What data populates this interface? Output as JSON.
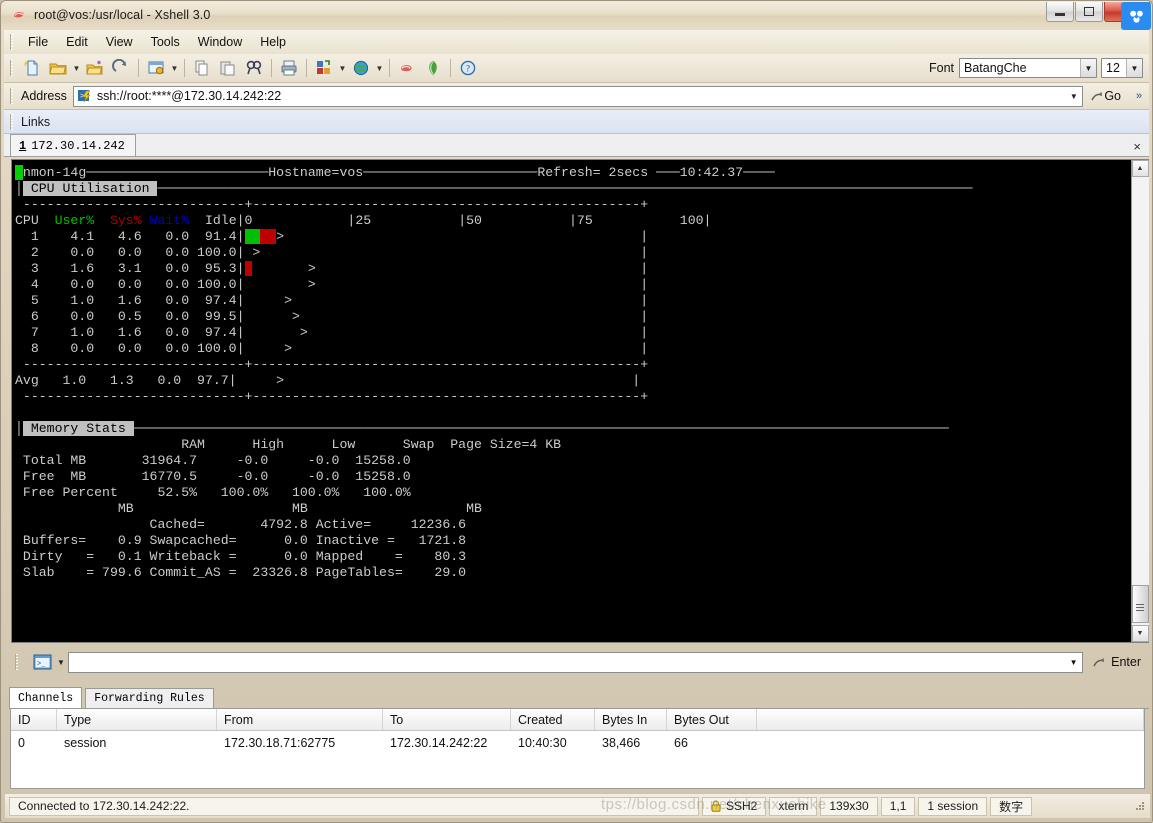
{
  "window": {
    "title": "root@vos:/usr/local - Xshell 3.0",
    "app_icon": "xshell-icon",
    "minimize_label": "Minimize",
    "maximize_label": "Maximize",
    "close_label": "X",
    "overlay_badge": "cloud-badge-icon"
  },
  "menubar": {
    "items": [
      "File",
      "Edit",
      "View",
      "Tools",
      "Window",
      "Help"
    ]
  },
  "toolbar": {
    "buttons": [
      {
        "name": "new-session-icon",
        "glyph": "new"
      },
      {
        "name": "open-folder-icon",
        "glyph": "folder"
      },
      {
        "name": "open-dropdown-arrow",
        "glyph": "arrow"
      },
      {
        "name": "open-session-icon",
        "glyph": "folder2"
      },
      {
        "name": "reconnect-icon",
        "glyph": "reconnect"
      },
      {
        "name": "properties-icon",
        "glyph": "props"
      },
      {
        "name": "properties-dropdown-arrow",
        "glyph": "arrow"
      },
      {
        "name": "copy-icon",
        "glyph": "copy"
      },
      {
        "name": "paste-icon",
        "glyph": "paste"
      },
      {
        "name": "find-icon",
        "glyph": "find"
      },
      {
        "name": "print-icon",
        "glyph": "print"
      },
      {
        "name": "transfer-icon",
        "glyph": "transfer"
      },
      {
        "name": "transfer-dropdown-arrow",
        "glyph": "arrow"
      },
      {
        "name": "web-icon",
        "glyph": "globe"
      },
      {
        "name": "web-dropdown-arrow",
        "glyph": "arrow"
      },
      {
        "name": "xshell-icon",
        "glyph": "xshell"
      },
      {
        "name": "xftp-icon",
        "glyph": "xftp"
      },
      {
        "name": "help-icon",
        "glyph": "help"
      }
    ],
    "font_label": "Font",
    "font_name": "BatangChe",
    "font_size": "12"
  },
  "address": {
    "label": "Address",
    "value": "ssh://root:****@172.30.14.242:22",
    "go_label": "Go",
    "chevron": "»"
  },
  "links": {
    "label": "Links"
  },
  "session_tab": {
    "number": "1",
    "name": "172.30.14.242",
    "close": "×"
  },
  "terminal": {
    "nmon": {
      "cursor": " ",
      "header_app": "nmon-14g",
      "header_hostname": "Hostname=vos",
      "header_refresh": "Refresh= 2secs",
      "header_time": "10:42.37",
      "cpu_panel_title": "CPU Utilisation",
      "cpu_columns": [
        "CPU",
        "User%",
        "Sys%",
        "Wait%",
        "Idle"
      ],
      "scale_labels": [
        "0",
        "|25",
        "|50",
        "|75",
        "100|"
      ],
      "cpu_rows": [
        {
          "cpu": "1",
          "user": "4.1",
          "sys": "4.6",
          "wait": "0.0",
          "idle": "91.4",
          "bar_u": 2,
          "bar_s": 2,
          "marker": 3
        },
        {
          "cpu": "2",
          "user": "0.0",
          "sys": "0.0",
          "wait": "0.0",
          "idle": "100.0",
          "bar_u": 0,
          "bar_s": 0,
          "marker": 1
        },
        {
          "cpu": "3",
          "user": "1.6",
          "sys": "3.1",
          "wait": "0.0",
          "idle": "95.3",
          "bar_u": 0,
          "bar_s": 1,
          "marker": 8
        },
        {
          "cpu": "4",
          "user": "0.0",
          "sys": "0.0",
          "wait": "0.0",
          "idle": "100.0",
          "bar_u": 0,
          "bar_s": 0,
          "marker": 8
        },
        {
          "cpu": "5",
          "user": "1.0",
          "sys": "1.6",
          "wait": "0.0",
          "idle": "97.4",
          "bar_u": 0,
          "bar_s": 0,
          "marker": 5
        },
        {
          "cpu": "6",
          "user": "0.0",
          "sys": "0.5",
          "wait": "0.0",
          "idle": "99.5",
          "bar_u": 0,
          "bar_s": 0,
          "marker": 6
        },
        {
          "cpu": "7",
          "user": "1.0",
          "sys": "1.6",
          "wait": "0.0",
          "idle": "97.4",
          "bar_u": 0,
          "bar_s": 0,
          "marker": 7
        },
        {
          "cpu": "8",
          "user": "0.0",
          "sys": "0.0",
          "wait": "0.0",
          "idle": "100.0",
          "bar_u": 0,
          "bar_s": 0,
          "marker": 5
        }
      ],
      "avg_row": {
        "cpu": "Avg",
        "user": "1.0",
        "sys": "1.3",
        "wait": "0.0",
        "idle": "97.7",
        "marker": 5
      },
      "mem_panel_title": "Memory Stats",
      "mem_headers": [
        "RAM",
        "High",
        "Low",
        "Swap",
        "Page Size=4 KB"
      ],
      "mem_rows": [
        {
          "label": "Total MB",
          "ram": "31964.7",
          "high": "-0.0",
          "low": "-0.0",
          "swap": "15258.0"
        },
        {
          "label": "Free  MB",
          "ram": "16770.5",
          "high": "-0.0",
          "low": "-0.0",
          "swap": "15258.0"
        },
        {
          "label": "Free Percent",
          "ram": "52.5%",
          "high": "100.0%",
          "low": "100.0%",
          "swap": "100.0%"
        }
      ],
      "mem_unit_row": [
        "MB",
        "MB",
        "MB"
      ],
      "mem_detail": [
        {
          "k1": "",
          "v1": "",
          "k2": "Cached=",
          "v2": "4792.8",
          "k3": "Active=",
          "v3": "12236.6"
        },
        {
          "k1": "Buffers=",
          "v1": "0.9",
          "k2": "Swapcached=",
          "v2": "0.0",
          "k3": "Inactive =",
          "v3": "1721.8"
        },
        {
          "k1": "Dirty   =",
          "v1": "0.1",
          "k2": "Writeback =",
          "v2": "0.0",
          "k3": "Mapped    =",
          "v3": "80.3"
        },
        {
          "k1": "Slab    =",
          "v1": "799.6",
          "k2": "Commit_AS =",
          "v2": "23326.8",
          "k3": "PageTables=",
          "v3": "29.0"
        }
      ]
    }
  },
  "command_row": {
    "icon": "terminal-icon",
    "input_value": "",
    "enter_label": "Enter"
  },
  "bottom_tabs": [
    {
      "label": "Channels",
      "active": true
    },
    {
      "label": "Forwarding Rules",
      "active": false
    }
  ],
  "channels_grid": {
    "columns": [
      "ID",
      "Type",
      "From",
      "To",
      "Created",
      "Bytes In",
      "Bytes Out"
    ],
    "rows": [
      {
        "id": "0",
        "type": "session",
        "from": "172.30.18.71:62775",
        "to": "172.30.14.242:22",
        "created": "10:40:30",
        "bytes_in": "38,466",
        "bytes_out": "66"
      }
    ]
  },
  "statusbar": {
    "message": "Connected to 172.30.14.242:22.",
    "lock_icon": "lock-icon",
    "protocol": "SSH2",
    "terminal_type": "xterm",
    "size": "139x30",
    "cursor_pos": "1,1",
    "sessions": "1 session",
    "ime": "数字"
  },
  "watermark": {
    "text": "tps://blog.csdn.net/chenxuebike"
  },
  "colors": {
    "terminal_bg": "#000000",
    "terminal_fg": "#cccccc",
    "user_green": "#00c000",
    "sys_red": "#b00000",
    "wait_blue": "#0000c8",
    "cursor_green": "#00d000",
    "title_bar": "#e9dfc9",
    "close_red": "#c33a2b",
    "badge_blue": "#2a8cf0"
  }
}
